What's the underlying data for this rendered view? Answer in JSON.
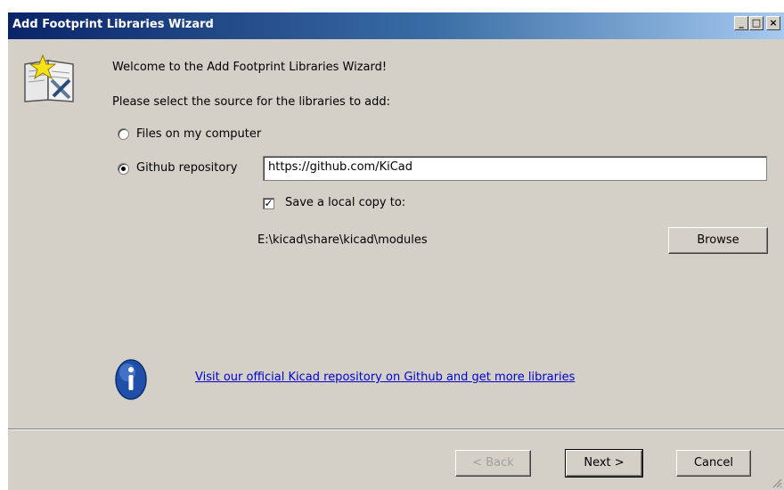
{
  "window": {
    "title": "Add Footprint Libraries Wizard",
    "title_bar_color": "#0a246a",
    "face_color": "#d4d0c8"
  },
  "wizard": {
    "welcome": "Welcome to the Add Footprint Libraries Wizard!",
    "prompt": "Please select the source for the libraries to add:",
    "option_files": "Files on my computer",
    "option_github": "Github repository",
    "github_url": "https://github.com/KiCad",
    "save_local": "Save a local copy to:",
    "save_local_checked": true,
    "selected_option": "github",
    "local_path": "E:\\kicad\\share\\kicad\\modules",
    "browse": "Browse",
    "info_link": "Visit our official Kicad repository on Github and get more libraries",
    "link_color": "#0000cc"
  },
  "buttons": {
    "back": "< Back",
    "next": "Next >",
    "cancel": "Cancel"
  },
  "icons": [
    "wizard-book-icon",
    "info-icon",
    "minimize-icon",
    "maximize-icon",
    "close-icon",
    "size-grip-icon"
  ]
}
